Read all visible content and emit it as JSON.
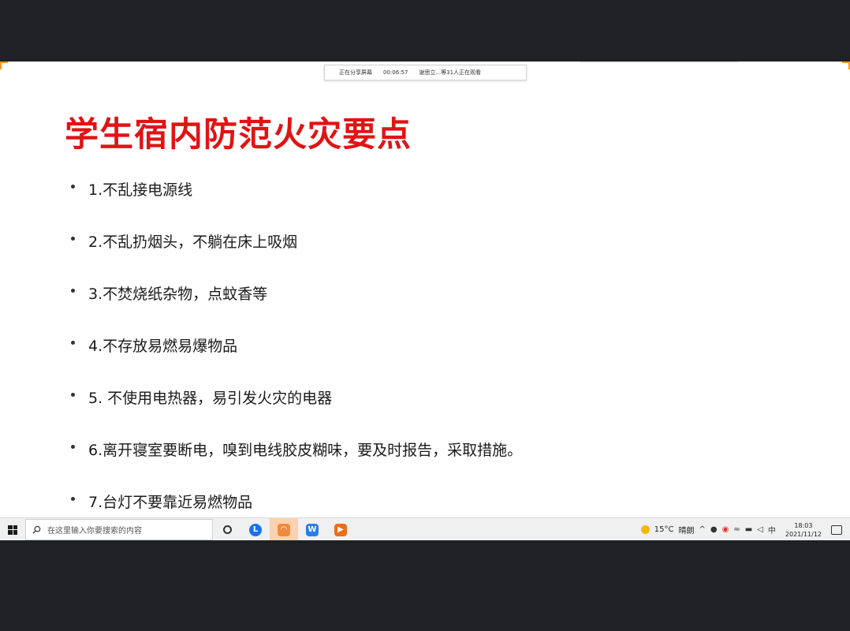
{
  "share_bar": {
    "status": "正在分享屏幕",
    "timer": "00:06:57",
    "viewers": "谢思立...等31人正在观看"
  },
  "slide": {
    "title": "学生宿内防范火灾要点",
    "bullets": [
      "1.不乱接电源线",
      "2.不乱扔烟头，不躺在床上吸烟",
      "3.不焚烧纸杂物，点蚊香等",
      "4.不存放易燃易爆物品",
      "5. 不使用电热器，易引发火灾的电器",
      "6.离开寝室要断电，嗅到电线胶皮糊味，要及时报告，采取措施。",
      "7.台灯不要靠近易燃物品"
    ],
    "title_color": "#e01414"
  },
  "taskbar": {
    "search_placeholder": "在这里输入你要搜索的内容",
    "weather_temp": "15°C",
    "weather_desc": "晴朗",
    "ime": "中",
    "time": "18:03",
    "date": "2021/11/12",
    "apps": [
      {
        "name": "task-view",
        "icon": "task-view-icon"
      },
      {
        "name": "browser",
        "icon": "browser-icon",
        "color": "#1a73e8",
        "glyph": "L"
      },
      {
        "name": "meeting",
        "icon": "meeting-icon",
        "color": "#f08a3c"
      },
      {
        "name": "wps",
        "icon": "wps-icon",
        "color": "#2b7de9",
        "glyph": "W"
      },
      {
        "name": "player",
        "icon": "player-icon",
        "color": "#ef6c1a",
        "glyph": "▶"
      }
    ]
  }
}
